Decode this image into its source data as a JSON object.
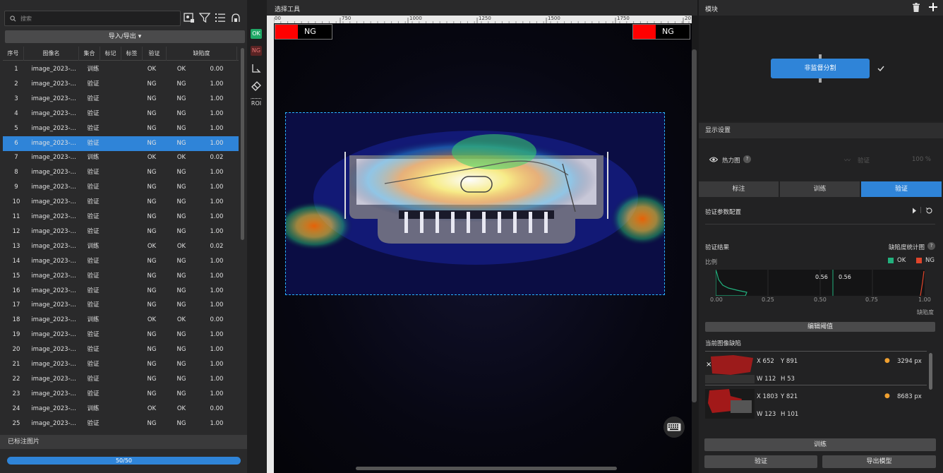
{
  "left": {
    "search_placeholder": "搜索",
    "io_label": "导入/导出",
    "columns": [
      "序号",
      "图像名",
      "集合",
      "标记",
      "标签",
      "验证",
      "缺陷度"
    ],
    "rows": [
      {
        "n": "1",
        "name": "image_2023-...",
        "set": "训练",
        "label": "OK",
        "verify": "OK",
        "score": "0.00"
      },
      {
        "n": "2",
        "name": "image_2023-...",
        "set": "验证",
        "label": "NG",
        "verify": "NG",
        "score": "1.00"
      },
      {
        "n": "3",
        "name": "image_2023-...",
        "set": "验证",
        "label": "NG",
        "verify": "NG",
        "score": "1.00"
      },
      {
        "n": "4",
        "name": "image_2023-...",
        "set": "验证",
        "label": "NG",
        "verify": "NG",
        "score": "1.00"
      },
      {
        "n": "5",
        "name": "image_2023-...",
        "set": "验证",
        "label": "NG",
        "verify": "NG",
        "score": "1.00"
      },
      {
        "n": "6",
        "name": "image_2023-...",
        "set": "验证",
        "label": "NG",
        "verify": "NG",
        "score": "1.00"
      },
      {
        "n": "7",
        "name": "image_2023-...",
        "set": "训练",
        "label": "OK",
        "verify": "OK",
        "score": "0.02"
      },
      {
        "n": "8",
        "name": "image_2023-...",
        "set": "验证",
        "label": "NG",
        "verify": "NG",
        "score": "1.00"
      },
      {
        "n": "9",
        "name": "image_2023-...",
        "set": "验证",
        "label": "NG",
        "verify": "NG",
        "score": "1.00"
      },
      {
        "n": "10",
        "name": "image_2023-...",
        "set": "验证",
        "label": "NG",
        "verify": "NG",
        "score": "1.00"
      },
      {
        "n": "11",
        "name": "image_2023-...",
        "set": "验证",
        "label": "NG",
        "verify": "NG",
        "score": "1.00"
      },
      {
        "n": "12",
        "name": "image_2023-...",
        "set": "验证",
        "label": "NG",
        "verify": "NG",
        "score": "1.00"
      },
      {
        "n": "13",
        "name": "image_2023-...",
        "set": "训练",
        "label": "OK",
        "verify": "OK",
        "score": "0.02"
      },
      {
        "n": "14",
        "name": "image_2023-...",
        "set": "验证",
        "label": "NG",
        "verify": "NG",
        "score": "1.00"
      },
      {
        "n": "15",
        "name": "image_2023-...",
        "set": "验证",
        "label": "NG",
        "verify": "NG",
        "score": "1.00"
      },
      {
        "n": "16",
        "name": "image_2023-...",
        "set": "验证",
        "label": "NG",
        "verify": "NG",
        "score": "1.00"
      },
      {
        "n": "17",
        "name": "image_2023-...",
        "set": "验证",
        "label": "NG",
        "verify": "NG",
        "score": "1.00"
      },
      {
        "n": "18",
        "name": "image_2023-...",
        "set": "训练",
        "label": "OK",
        "verify": "OK",
        "score": "0.00"
      },
      {
        "n": "19",
        "name": "image_2023-...",
        "set": "验证",
        "label": "NG",
        "verify": "NG",
        "score": "1.00"
      },
      {
        "n": "20",
        "name": "image_2023-...",
        "set": "验证",
        "label": "NG",
        "verify": "NG",
        "score": "1.00"
      },
      {
        "n": "21",
        "name": "image_2023-...",
        "set": "验证",
        "label": "NG",
        "verify": "NG",
        "score": "1.00"
      },
      {
        "n": "22",
        "name": "image_2023-...",
        "set": "验证",
        "label": "NG",
        "verify": "NG",
        "score": "1.00"
      },
      {
        "n": "23",
        "name": "image_2023-...",
        "set": "验证",
        "label": "NG",
        "verify": "NG",
        "score": "1.00"
      },
      {
        "n": "24",
        "name": "image_2023-...",
        "set": "训练",
        "label": "OK",
        "verify": "OK",
        "score": "0.00"
      },
      {
        "n": "25",
        "name": "image_2023-...",
        "set": "验证",
        "label": "NG",
        "verify": "NG",
        "score": "1.00"
      }
    ],
    "selected_row": 6,
    "labeled_title": "已标注图片",
    "progress_text": "50/50",
    "progress": 1.0
  },
  "tools": {
    "ok": "OK",
    "ng": "NG",
    "roi": "ROI"
  },
  "canvas": {
    "title": "选择工具",
    "ruler_ticks": [
      "00",
      "750",
      "1000",
      "1250",
      "1500",
      "1750",
      "20"
    ],
    "ng_left": "NG",
    "ng_right": "NG"
  },
  "right": {
    "module_title": "模块",
    "module_button": "非监督分割",
    "display_title": "显示设置",
    "heatmap_label": "热力图",
    "verify_dim": "验证",
    "opacity": "100 %",
    "tabs": [
      "标注",
      "训练",
      "验证"
    ],
    "active_tab": 2,
    "verify_params": "验证参数配置",
    "verify_result": "验证结果",
    "stat_chart": "缺陷度统计图",
    "ratio": "比例",
    "legend_ok": "OK",
    "legend_ng": "NG",
    "colors": {
      "ok": "#22b07d",
      "ng": "#e0452b",
      "accent": "#2f84d8"
    },
    "threshold_left": "0.56",
    "threshold_right": "0.56",
    "x_ticks": [
      "0.00",
      "0.25",
      "0.50",
      "0.75",
      "1.00"
    ],
    "x_label": "缺陷度",
    "edit_threshold": "编辑阈值",
    "current_defects": "当前图像缺陷",
    "defects": [
      {
        "x": "652",
        "y": "891",
        "w": "112",
        "h": "53",
        "area": "3294 px"
      },
      {
        "x": "1803",
        "y": "821",
        "w": "123",
        "h": "101",
        "area": "8683 px"
      }
    ],
    "train_btn": "训练",
    "verify_btn": "验证",
    "export_btn": "导出模型"
  }
}
